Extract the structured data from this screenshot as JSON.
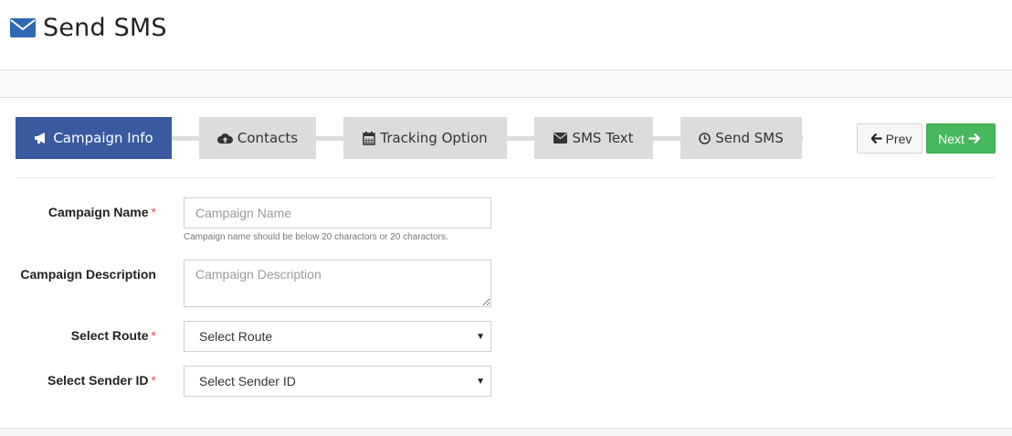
{
  "header": {
    "title": "Send SMS",
    "icon": "envelope-icon",
    "icon_color": "#2e6ab3"
  },
  "wizard": {
    "active_color": "#3a5aa0",
    "inactive_color": "#dcdcdc",
    "steps": [
      {
        "label": "Campaign Info",
        "icon": "bullhorn-icon",
        "active": true
      },
      {
        "label": "Contacts",
        "icon": "cloud-upload-icon",
        "active": false
      },
      {
        "label": "Tracking Option",
        "icon": "calendar-icon",
        "active": false
      },
      {
        "label": "SMS Text",
        "icon": "envelope-icon",
        "active": false
      },
      {
        "label": "Send SMS",
        "icon": "clock-icon",
        "active": false
      }
    ]
  },
  "nav": {
    "prev_label": "Prev",
    "next_label": "Next",
    "next_color": "#46b75b"
  },
  "form": {
    "campaign_name": {
      "label": "Campaign Name",
      "required": "*",
      "placeholder": "Campaign Name",
      "value": "",
      "help": "Campaign name should be below 20 charactors or 20 charactors."
    },
    "campaign_description": {
      "label": "Campaign Description",
      "placeholder": "Campaign Description",
      "value": ""
    },
    "route": {
      "label": "Select Route",
      "required": "*",
      "selected": "Select Route"
    },
    "sender_id": {
      "label": "Select Sender ID",
      "required": "*",
      "selected": "Select Sender ID"
    }
  }
}
